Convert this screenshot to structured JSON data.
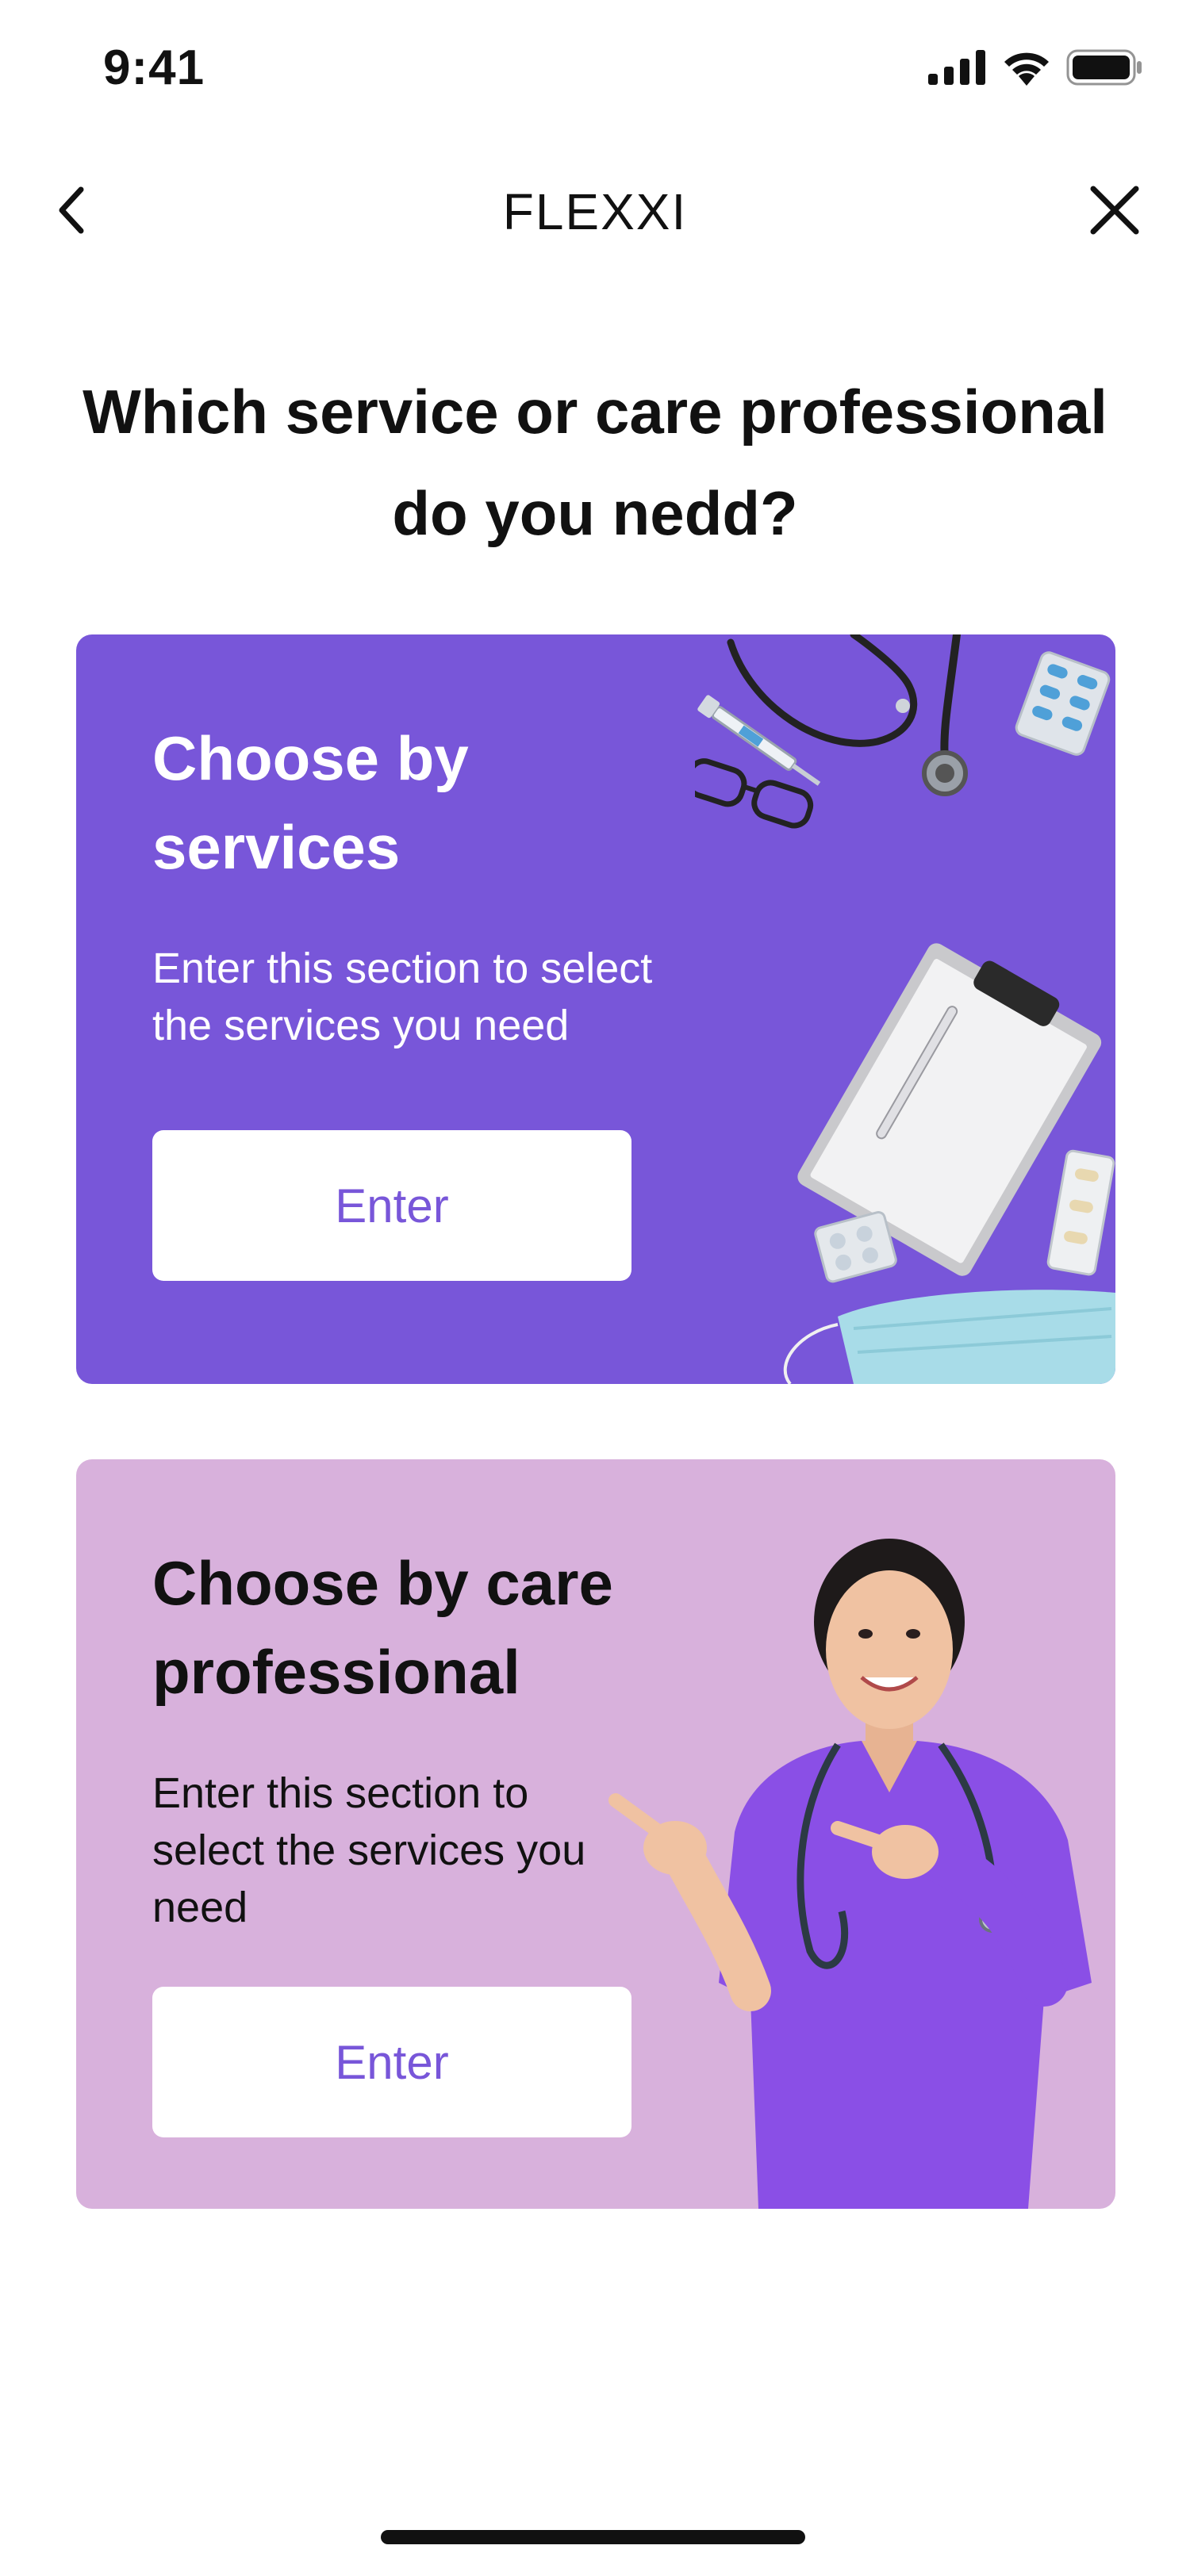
{
  "status_bar": {
    "time": "9:41"
  },
  "nav": {
    "title": "FLEXXI"
  },
  "page": {
    "title": "Which service or care professional do you nedd?"
  },
  "cards": [
    {
      "title": "Choose by services",
      "description": "Enter this section to select the services you need",
      "button_label": "Enter",
      "color": "#7856d9"
    },
    {
      "title": "Choose by care professional",
      "description": "Enter this section to select the services you need",
      "button_label": "Enter",
      "color": "#d8b1dc"
    }
  ],
  "colors": {
    "accent": "#7856d9",
    "card_pink": "#d8b1dc",
    "text": "#111111"
  },
  "icons": [
    "signal-icon",
    "wifi-icon",
    "battery-icon",
    "back-chevron-icon",
    "close-icon"
  ]
}
